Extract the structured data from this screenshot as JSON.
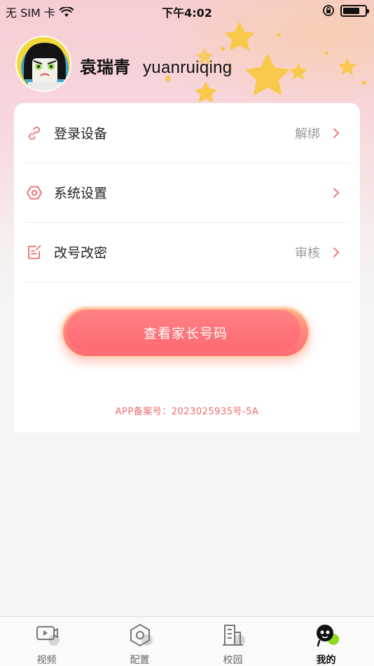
{
  "status_bar": {
    "carrier": "无 SIM 卡",
    "time": "下午4:02",
    "battery_level": 0.75
  },
  "profile": {
    "name_cn": "袁瑞青",
    "name_en": "yuanruiqing"
  },
  "menu": [
    {
      "label": "登录设备",
      "value": "解绑",
      "icon": "link-icon"
    },
    {
      "label": "系统设置",
      "value": "",
      "icon": "hexagon-settings-icon"
    },
    {
      "label": "改号改密",
      "value": "审核",
      "icon": "edit-note-icon"
    }
  ],
  "cta_label": "查看家长号码",
  "icp": "APP备案号：2023025935号-5A",
  "tabs": [
    {
      "label": "视频",
      "icon": "video-icon",
      "active": false
    },
    {
      "label": "配置",
      "icon": "hexagon-icon",
      "active": false
    },
    {
      "label": "校园",
      "icon": "building-icon",
      "active": false
    },
    {
      "label": "我的",
      "icon": "profile-face-icon",
      "active": true
    }
  ],
  "colors": {
    "accent": "#ff6a72",
    "icon_accent": "#f06a6a",
    "star": "#f8c94a",
    "active_dot": "#8ed81f"
  }
}
